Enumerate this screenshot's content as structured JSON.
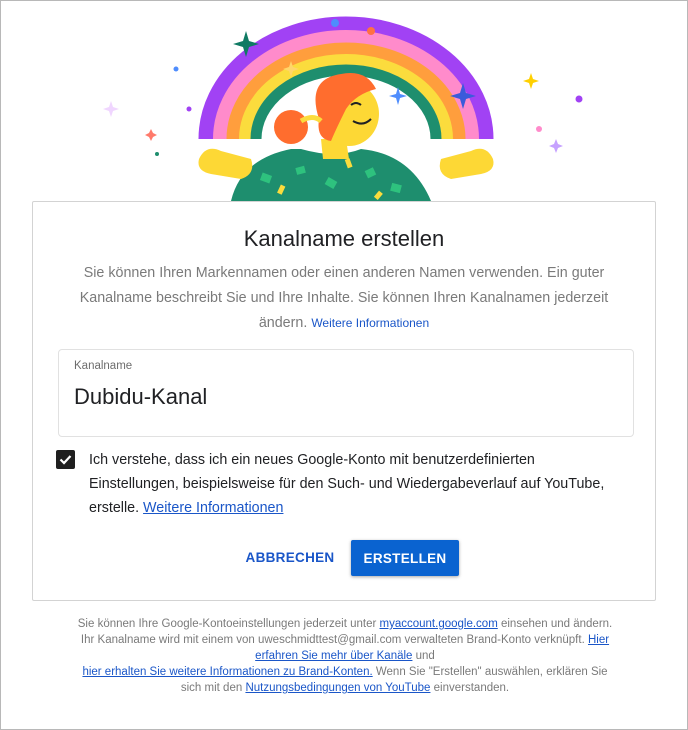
{
  "card": {
    "title": "Kanalname erstellen",
    "description": "Sie können Ihren Markennamen oder einen anderen Namen verwenden. Ein guter Kanalname beschreibt Sie und Ihre Inhalte. Sie können Ihren Kanalnamen jederzeit ändern.",
    "description_link": "Weitere Informationen"
  },
  "field": {
    "label": "Kanalname",
    "value": "Dubidu-Kanal"
  },
  "consent": {
    "checked": true,
    "text": "Ich verstehe, dass ich ein neues Google-Konto mit benutzerdefinierten Einstellungen, beispielsweise für den Such- und Wiedergabeverlauf auf YouTube, erstelle.",
    "link": "Weitere Informationen"
  },
  "buttons": {
    "cancel": "ABBRECHEN",
    "create": "ERSTELLEN"
  },
  "footer": {
    "part1": "Sie können Ihre Google-Kontoeinstellungen jederzeit unter",
    "link_account": "myaccount.google.com",
    "part2": "einsehen und ändern. Ihr Kanalname wird mit einem von uweschmidttest@gmail.com verwalteten Brand-Konto verknüpft.",
    "link_channels": "Hier erfahren Sie mehr über Kanäle",
    "part3": "und",
    "link_brand": "hier erhalten Sie weitere Informationen zu Brand-Konten.",
    "part4": "Wenn Sie \"Erstellen\" auswählen, erklären Sie sich mit den",
    "link_terms": "Nutzungsbedingungen von YouTube",
    "part5": "einverstanden."
  },
  "colors": {
    "link": "#1a56c8",
    "primary_button": "#0a63d0",
    "checkbox": "#1f1f1f"
  },
  "icons": {
    "illustration": "celebrating-person-rainbow-illustration",
    "checkbox": "checkmark-icon"
  }
}
